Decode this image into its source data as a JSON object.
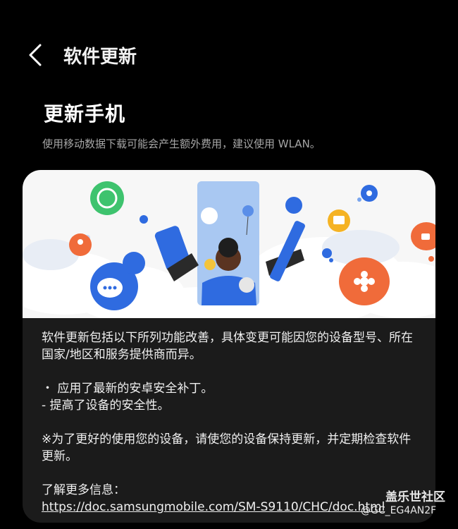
{
  "header": {
    "title": "软件更新"
  },
  "page": {
    "heading": "更新手机",
    "subtitle": "使用移动数据下载可能会产生额外费用，建议使用 WLAN。"
  },
  "notes": {
    "intro": "软件更新包括以下所列功能改善，具体变更可能因您的设备型号、所在国家/地区和服务提供商而异。",
    "bullet1": "・ 应用了最新的安卓安全补丁。",
    "bullet2": "- 提高了设备的安全性。",
    "advice": "※为了更好的使用您的设备，请使您的设备保持更新，并定期检查软件更新。",
    "more_label": "了解更多信息：",
    "more_url": "https://doc.samsungmobile.com/SM-S9110/CHC/doc.html"
  },
  "watermark": {
    "brand": "盖乐世社区",
    "handle": "@GC_EG4AN2F"
  },
  "colors": {
    "background": "#000000",
    "card": "#1b1b1b",
    "banner": "#f7f7f7",
    "accent_blue": "#2f6be0",
    "accent_orange": "#f06b3a"
  }
}
